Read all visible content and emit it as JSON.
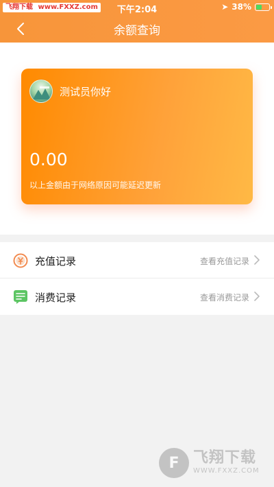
{
  "status_bar": {
    "carrier_badge": "飞翔下载",
    "carrier_url": "www.FXXZ.com",
    "time": "下午2:04",
    "battery": "38%"
  },
  "nav": {
    "title": "余额查询",
    "back_icon": "chevron-left-icon"
  },
  "card": {
    "greeting": "测试员你好",
    "balance": "0.00",
    "note": "以上金额由于网络原因可能延迟更新",
    "gradient_colors": [
      "#ff8a00",
      "#ffb945"
    ]
  },
  "records": [
    {
      "label": "充值记录",
      "link": "查看充值记录",
      "icon": "yuan-coin-icon",
      "icon_color": "#f28b50"
    },
    {
      "label": "消费记录",
      "link": "查看消费记录",
      "icon": "receipt-icon",
      "icon_color": "#5cc563"
    }
  ],
  "watermark": {
    "logo_char": "F",
    "title": "飞翔下载",
    "url": "WWW.FXXZ.COM"
  },
  "colors": {
    "header": "#f7953a",
    "background": "#f2f2f2"
  }
}
